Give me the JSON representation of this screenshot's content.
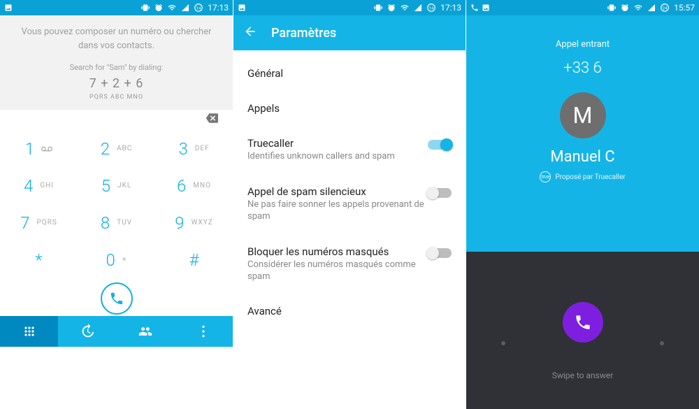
{
  "statusbar": {
    "time1": "17:13",
    "time2": "17:13",
    "time3": "15:57"
  },
  "dialer": {
    "help": "Vous pouvez composer un numéro ou chercher dans vos contacts.",
    "search_hint": "Search for \"Sam\" by dialing:",
    "dial_example": "7 + 2 + 6",
    "dial_sub": "PQRS   ABC   MNO",
    "keys": [
      {
        "n": "1",
        "l": ""
      },
      {
        "n": "2",
        "l": "ABC"
      },
      {
        "n": "3",
        "l": "DEF"
      },
      {
        "n": "4",
        "l": "GHI"
      },
      {
        "n": "5",
        "l": "JKL"
      },
      {
        "n": "6",
        "l": "MNO"
      },
      {
        "n": "7",
        "l": "PQRS"
      },
      {
        "n": "8",
        "l": "TUV"
      },
      {
        "n": "9",
        "l": "WXYZ"
      },
      {
        "n": "*",
        "l": ""
      },
      {
        "n": "0",
        "l": "+"
      },
      {
        "n": "#",
        "l": ""
      }
    ]
  },
  "settings": {
    "title": "Paramètres",
    "items": {
      "general": "Général",
      "calls": "Appels",
      "truecaller_title": "Truecaller",
      "truecaller_sub": "Identifies unknown callers and spam",
      "silentspam_title": "Appel de spam silencieux",
      "silentspam_sub": "Ne pas faire sonner les appels provenant de spam",
      "blockmasked_title": "Bloquer les numéros masqués",
      "blockmasked_sub": "Considérer les numéros masqués comme spam",
      "advanced": "Avancé"
    }
  },
  "call": {
    "status": "Appel entrant",
    "number": "+33 6",
    "initial": "M",
    "name": "Manuel C",
    "truecaller_badge": "true",
    "truecaller_text": "Proposé par Truecaller",
    "swipe": "Swipe to answer"
  }
}
